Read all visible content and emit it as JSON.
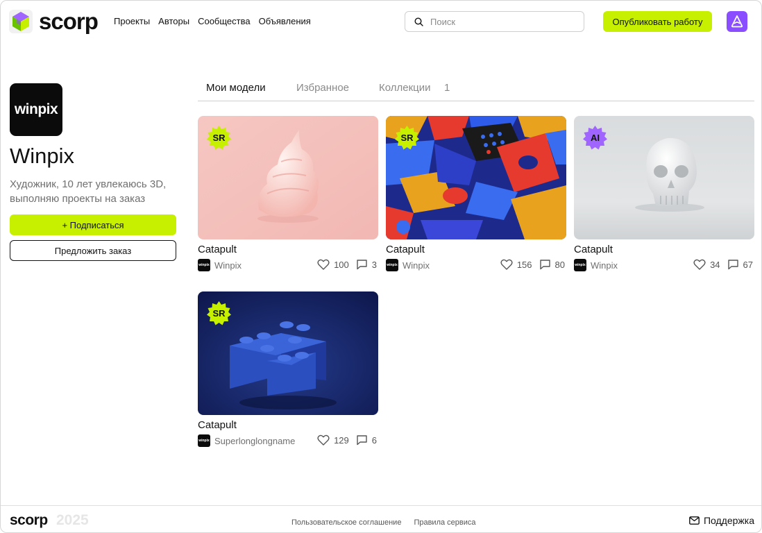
{
  "header": {
    "logo_text": "scorp",
    "nav": [
      "Проекты",
      "Авторы",
      "Сообщества",
      "Объявления"
    ],
    "search_placeholder": "Поиск",
    "publish_label": "Опубликовать работу"
  },
  "profile": {
    "avatar_text": "winpix",
    "name": "Winpix",
    "bio": "Художник, 10 лет увлекаюсь 3D, выполняю проекты на заказ",
    "subscribe_label": "+  Подписаться",
    "order_label": "Предложить заказ"
  },
  "tabs": {
    "models": "Мои модели",
    "favorites": "Избранное",
    "collections": "Коллекции",
    "collections_count": "1"
  },
  "cards": [
    {
      "badge": "SR",
      "badge_color": "#c6f000",
      "title": "Catapult",
      "author": "Winpix",
      "likes": "100",
      "comments": "3",
      "mini_avatar": "winpix"
    },
    {
      "badge": "SR",
      "badge_color": "#c6f000",
      "title": "Catapult",
      "author": "Winpix",
      "likes": "156",
      "comments": "80",
      "mini_avatar": "winpix"
    },
    {
      "badge": "AI",
      "badge_color": "#a064ff",
      "title": "Catapult",
      "author": "Winpix",
      "likes": "34",
      "comments": "67",
      "mini_avatar": "winpix"
    },
    {
      "badge": "SR",
      "badge_color": "#c6f000",
      "title": "Catapult",
      "author": "Superlonglongname",
      "likes": "129",
      "comments": "6",
      "mini_avatar": "winpix"
    }
  ],
  "footer": {
    "logo": "scorp",
    "year": "2025",
    "links": [
      "Пользовательское соглашение",
      "Правила сервиса"
    ],
    "support": "Поддержка"
  },
  "colors": {
    "accent": "#c6f000",
    "brand_purple": "#8a4dff"
  }
}
